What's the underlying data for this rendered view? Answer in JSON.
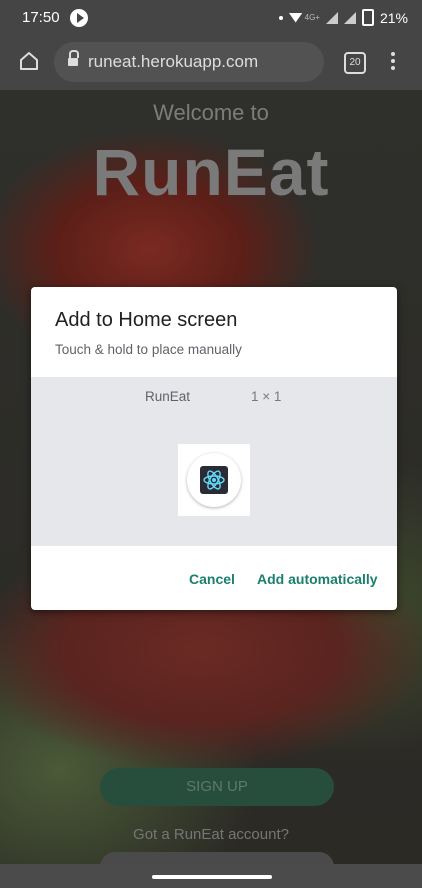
{
  "status_bar": {
    "time": "17:50",
    "network": "4G+",
    "battery": "21%"
  },
  "browser": {
    "url": "runeat.herokuapp.com",
    "tab_count": "20"
  },
  "page": {
    "welcome_text": "Welcome to",
    "brand_name": "RunEat",
    "signup_label": "SIGN UP",
    "account_prompt": "Got a RunEat account?"
  },
  "dialog": {
    "title": "Add to Home screen",
    "subtitle": "Touch & hold to place manually",
    "app_name": "RunEat",
    "widget_size": "1 × 1",
    "cancel_label": "Cancel",
    "add_label": "Add automatically",
    "accent_color": "#1b7f6e"
  },
  "icons": {
    "home": "home-icon",
    "lock": "lock-icon",
    "tabs": "tab-switcher-icon",
    "menu": "more-vert-icon",
    "app": "react-atom-icon"
  }
}
